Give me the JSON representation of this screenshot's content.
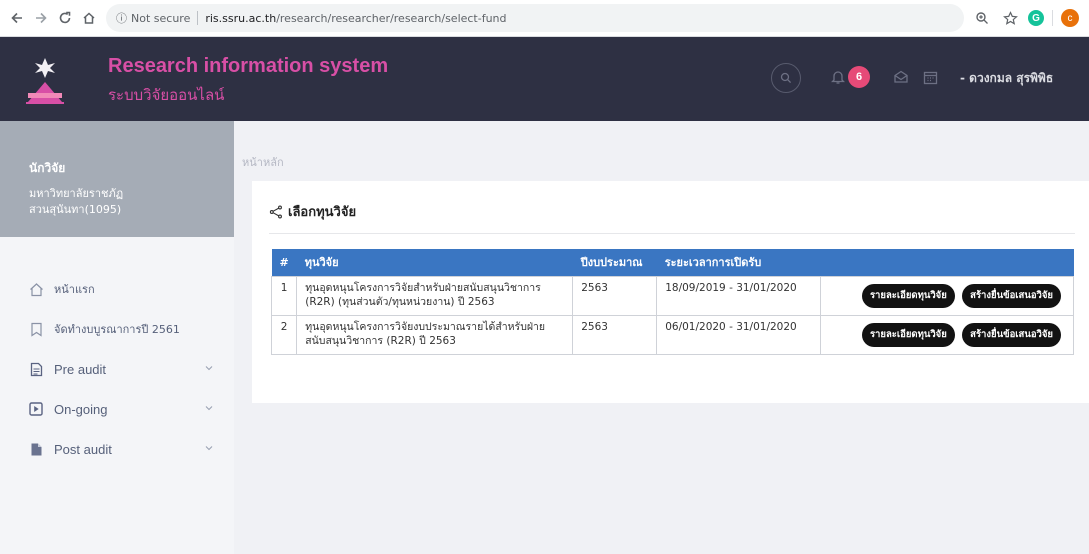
{
  "browser": {
    "security_label": "Not secure",
    "host": "ris.ssru.ac.th",
    "path": "/research/researcher/research/select-fund",
    "avatar_letter": "c",
    "extension_letter": "G"
  },
  "header": {
    "title": "Research information system",
    "subtitle": "ระบบวิจัยออนไลน์",
    "notification_count": "6",
    "user_name": "- ดวงกมล สุรพิพิธ"
  },
  "profile": {
    "role": "นักวิจัย",
    "org_line1": "มหาวิทยาลัยราชภัฏ",
    "org_line2": "สวนสุนันทา(1095)"
  },
  "menu": {
    "home": "หน้าแรก",
    "budget": "จัดทำงบบูรณาการปี 2561",
    "pre_audit": "Pre audit",
    "on_going": "On-going",
    "post_audit": "Post audit"
  },
  "breadcrumb": "หน้าหลัก",
  "card": {
    "title": "เลือกทุนวิจัย",
    "columns": {
      "num": "#",
      "fund": "ทุนวิจัย",
      "year": "ปีงบประมาณ",
      "period": "ระยะเวลาการเปิดรับ",
      "actions": ""
    },
    "rows": [
      {
        "num": "1",
        "fund": "ทุนอุดหนุนโครงการวิจัยสำหรับฝ่ายสนับสนุนวิชาการ (R2R) (ทุนส่วนตัว/ทุนหน่วยงาน) ปี 2563",
        "year": "2563",
        "period": "18/09/2019 - 31/01/2020",
        "detail_label": "รายละเอียดทุนวิจัย",
        "submit_label": "สร้างยื่นข้อเสนอวิจัย"
      },
      {
        "num": "2",
        "fund": "ทุนอุดหนุนโครงการวิจัยงบประมาณรายได้สำหรับฝ่ายสนับสนุนวิชาการ (R2R) ปี 2563",
        "year": "2563",
        "period": "06/01/2020 - 31/01/2020",
        "detail_label": "รายละเอียดทุนวิจัย",
        "submit_label": "สร้างยื่นข้อเสนอวิจัย"
      }
    ]
  },
  "colors": {
    "header_bg": "#2e3043",
    "brand_pink": "#d84fa6",
    "table_head": "#3a76c2",
    "badge": "#e64a78"
  }
}
